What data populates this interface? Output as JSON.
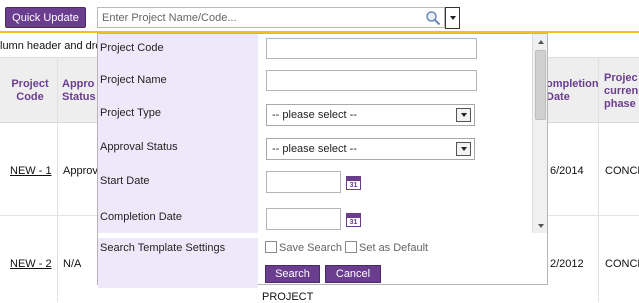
{
  "toolbar": {
    "quick_update_label": "Quick Update",
    "search_placeholder": "Enter Project Name/Code..."
  },
  "hint_text": "lumn header and dro",
  "table": {
    "headers": [
      {
        "line1": "Project",
        "line2": "Code"
      },
      {
        "line1": "Appro",
        "line2": "Status"
      },
      {
        "line1": "ompletion",
        "line2": "Date"
      },
      {
        "line1": "Projec",
        "line2": "curren",
        "line3": "phase"
      }
    ],
    "rows": [
      {
        "code": "NEW - 1",
        "status": "Approv",
        "date": "6/2014",
        "phase": "CONCE"
      },
      {
        "code": "NEW - 2",
        "status": "N/A",
        "date": "2/2012",
        "phase": "CONCE"
      }
    ],
    "partial_text": "PROJECT"
  },
  "search_panel": {
    "fields": {
      "project_code": "Project Code",
      "project_name": "Project Name",
      "project_type": "Project Type",
      "approval_status": "Approval Status",
      "start_date": "Start Date",
      "completion_date": "Completion Date",
      "template_settings": "Search Template Settings"
    },
    "select_default": "-- please select --",
    "calendar_text": "31",
    "save_search_label": "Save Search",
    "set_default_label": "Set as Default",
    "search_button": "Search",
    "cancel_button": "Cancel"
  },
  "colors": {
    "accent": "#6a3d8f",
    "label_bg": "#efe8fb",
    "top_border": "#f0c020"
  },
  "icons": [
    "search-icon",
    "chevron-down-icon",
    "calendar-icon"
  ]
}
